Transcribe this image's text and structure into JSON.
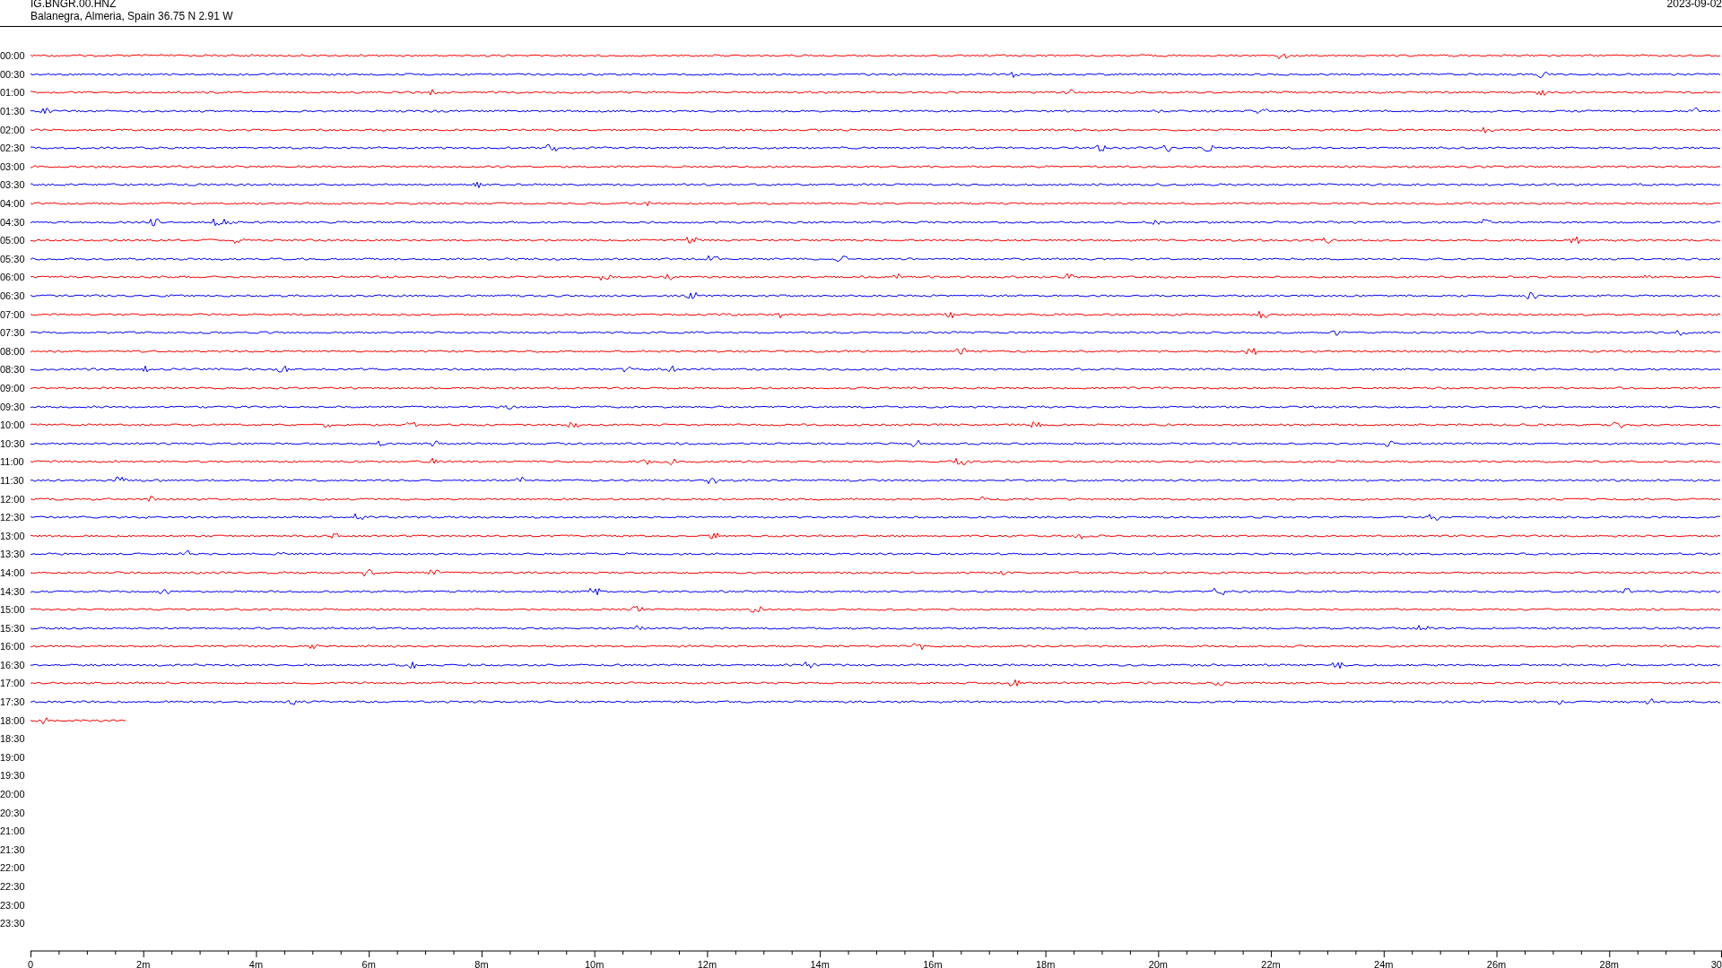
{
  "header": {
    "station": "IG.BNGR.00.HNZ",
    "location": "Balanegra, Almeria, Spain  36.75 N 2.91 W",
    "date": "2023-09-02"
  },
  "rows": [
    {
      "time": "00:00",
      "color": "#ff0000",
      "level": 1
    },
    {
      "time": "00:30",
      "color": "#0000ff",
      "level": 1
    },
    {
      "time": "01:00",
      "color": "#ff0000",
      "level": 1
    },
    {
      "time": "01:30",
      "color": "#0000ff",
      "level": 1
    },
    {
      "time": "02:00",
      "color": "#ff0000",
      "level": 1
    },
    {
      "time": "02:30",
      "color": "#0000ff",
      "level": 1
    },
    {
      "time": "03:00",
      "color": "#ff0000",
      "level": 1
    },
    {
      "time": "03:30",
      "color": "#0000ff",
      "level": 1
    },
    {
      "time": "04:00",
      "color": "#ff0000",
      "level": 1
    },
    {
      "time": "04:30",
      "color": "#0000ff",
      "level": 1
    },
    {
      "time": "05:00",
      "color": "#ff0000",
      "level": 1
    },
    {
      "time": "05:30",
      "color": "#0000ff",
      "level": 1
    },
    {
      "time": "06:00",
      "color": "#ff0000",
      "level": 1
    },
    {
      "time": "06:30",
      "color": "#0000ff",
      "level": 1
    },
    {
      "time": "07:00",
      "color": "#ff0000",
      "level": 1
    },
    {
      "time": "07:30",
      "color": "#0000ff",
      "level": 1
    },
    {
      "time": "08:00",
      "color": "#ff0000",
      "level": 1
    },
    {
      "time": "08:30",
      "color": "#0000ff",
      "level": 1
    },
    {
      "time": "09:00",
      "color": "#ff0000",
      "level": 1
    },
    {
      "time": "09:30",
      "color": "#0000ff",
      "level": 1
    },
    {
      "time": "10:00",
      "color": "#ff0000",
      "level": 1
    },
    {
      "time": "10:30",
      "color": "#0000ff",
      "level": 1
    },
    {
      "time": "11:00",
      "color": "#ff0000",
      "level": 1
    },
    {
      "time": "11:30",
      "color": "#0000ff",
      "level": 1
    },
    {
      "time": "12:00",
      "color": "#ff0000",
      "level": 1
    },
    {
      "time": "12:30",
      "color": "#0000ff",
      "level": 1
    },
    {
      "time": "13:00",
      "color": "#ff0000",
      "level": 1
    },
    {
      "time": "13:30",
      "color": "#0000ff",
      "level": 1
    },
    {
      "time": "14:00",
      "color": "#ff0000",
      "level": 1
    },
    {
      "time": "14:30",
      "color": "#0000ff",
      "level": 1
    },
    {
      "time": "15:00",
      "color": "#ff0000",
      "level": 1
    },
    {
      "time": "15:30",
      "color": "#0000ff",
      "level": 1
    },
    {
      "time": "16:00",
      "color": "#ff0000",
      "level": 1
    },
    {
      "time": "16:30",
      "color": "#0000ff",
      "level": 1
    },
    {
      "time": "17:00",
      "color": "#ff0000",
      "level": 1
    },
    {
      "time": "17:30",
      "color": "#0000ff",
      "level": 1
    },
    {
      "time": "18:00",
      "color": "#ff0000",
      "level": 0.057
    },
    {
      "time": "18:30"
    },
    {
      "time": "19:00"
    },
    {
      "time": "19:30"
    },
    {
      "time": "20:00"
    },
    {
      "time": "20:30"
    },
    {
      "time": "21:00"
    },
    {
      "time": "21:30"
    },
    {
      "time": "22:00"
    },
    {
      "time": "22:30"
    },
    {
      "time": "23:00"
    },
    {
      "time": "23:30"
    }
  ],
  "x_axis": {
    "labels": [
      "0",
      "2m",
      "4m",
      "6m",
      "8m",
      "10m",
      "12m",
      "14m",
      "16m",
      "18m",
      "20m",
      "22m",
      "24m",
      "26m",
      "28m",
      "30"
    ]
  }
}
